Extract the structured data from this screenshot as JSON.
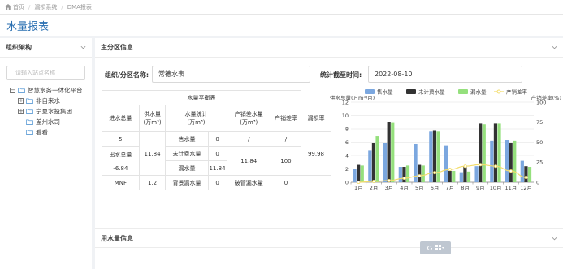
{
  "breadcrumb": {
    "items": [
      "首页",
      "漏损系统",
      "DMA报表"
    ]
  },
  "page": {
    "title": "水量报表"
  },
  "left_panel": {
    "title": "组织架构",
    "search_placeholder": "请输入站点名称",
    "tree": [
      {
        "label": "智慧水务一体化平台",
        "level": 0,
        "expander": "−"
      },
      {
        "label": "非自来水",
        "level": 1,
        "expander": "+"
      },
      {
        "label": "宁夏水投集团",
        "level": 1,
        "expander": "+"
      },
      {
        "label": "盖州水司",
        "level": 2,
        "expander": ""
      },
      {
        "label": "看看",
        "level": 2,
        "expander": ""
      }
    ]
  },
  "main": {
    "title": "主分区信息",
    "org_label": "组织/分区名称:",
    "org_value": "常德水表",
    "date_label": "统计截至时间:",
    "date_value": "2022-08-10",
    "table": {
      "caption": "水量平衡表",
      "h_supply_total": "进水总量",
      "h_supply": "供水量",
      "h_supply_unit": "(万m³)",
      "h_stats": "水量统计",
      "h_stats_unit": "(万m³)",
      "h_diff": "产销差水量",
      "h_diff_unit": "(万m³)",
      "h_diff_rate": "产销差率",
      "h_loss_rate": "漏损率",
      "c_in_total": "5",
      "c_out_label": "出水总量",
      "c_out_value": "-6.84",
      "c_supply": "11.84",
      "r1_name": "售水量",
      "r1_val": "0",
      "r1_diff": "/",
      "r1_rate": "/",
      "r2_name": "未计费水量",
      "r2_val": "0",
      "r3_name": "漏水量",
      "r3_val": "11.84",
      "diff_value": "11.84",
      "diff_rate": "100",
      "loss_rate": "99.98",
      "mnf_label": "MNF",
      "mnf_value": "1.2",
      "bg_name": "背景漏水量",
      "bg_val": "0",
      "burst_name": "破管漏水量",
      "burst_val": "0"
    }
  },
  "section2": {
    "title": "用水量信息"
  },
  "colors": {
    "accent": "#2a6fb1",
    "supply": "#7ba7df",
    "unbilled": "#333333",
    "leak": "#95e07d",
    "rate": "#f2dc6b"
  },
  "chart_data": {
    "type": "bar",
    "categories": [
      "1月",
      "2月",
      "3月",
      "4月",
      "5月",
      "6月",
      "7月",
      "8月",
      "9月",
      "10月",
      "11月",
      "12月"
    ],
    "series": [
      {
        "name": "售水量",
        "values": [
          2.0,
          4.8,
          5.9,
          2.3,
          5.7,
          7.6,
          5.5,
          1.5,
          2.4,
          6.2,
          6.3,
          3.2
        ]
      },
      {
        "name": "未计费水量",
        "values": [
          2.6,
          5.9,
          9.0,
          2.3,
          2.6,
          7.7,
          1.7,
          2.4,
          8.8,
          8.8,
          5.9,
          2.4
        ]
      },
      {
        "name": "漏水量",
        "values": [
          2.5,
          6.9,
          8.9,
          2.5,
          2.5,
          7.6,
          1.7,
          1.6,
          8.7,
          8.8,
          6.2,
          2.3
        ]
      },
      {
        "name": "产销差率",
        "values": [
          0,
          1,
          2,
          5,
          8,
          12,
          16,
          20,
          22,
          20,
          14,
          6
        ]
      }
    ],
    "y_left": {
      "label": "供水总量(万m³/月)",
      "min": 0,
      "max": 12,
      "ticks": [
        "0",
        "2",
        "4",
        "6",
        "8",
        "10",
        "12"
      ]
    },
    "y_right": {
      "label": "产销差率(%)",
      "min": 0,
      "max": 100,
      "ticks": [
        "0",
        "25",
        "50",
        "75",
        "100"
      ]
    },
    "legend_position": "top",
    "grid": true
  }
}
